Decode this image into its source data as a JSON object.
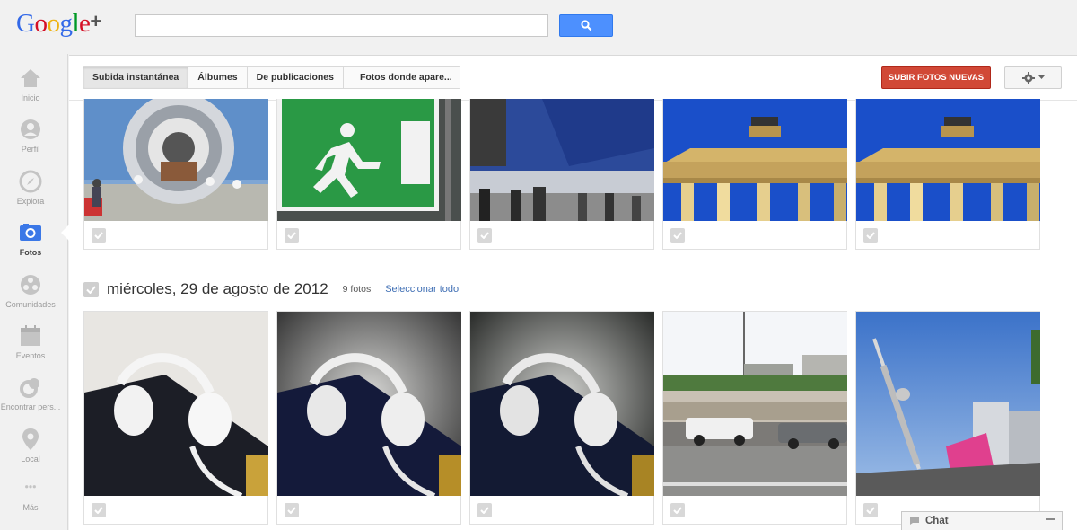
{
  "header": {
    "logo_text": "Google+",
    "search_placeholder": "",
    "search_icon": "search-icon"
  },
  "nav": {
    "items": [
      {
        "label": "Inicio",
        "icon": "home-icon"
      },
      {
        "label": "Perfil",
        "icon": "profile-icon"
      },
      {
        "label": "Explora",
        "icon": "compass-icon"
      },
      {
        "label": "Fotos",
        "icon": "camera-icon"
      },
      {
        "label": "Comunidades",
        "icon": "communities-icon"
      },
      {
        "label": "Eventos",
        "icon": "calendar-icon"
      },
      {
        "label": "Encontrar pers...",
        "icon": "find-people-icon"
      },
      {
        "label": "Local",
        "icon": "pin-icon"
      },
      {
        "label": "Más",
        "icon": "more-icon"
      }
    ],
    "active": "Fotos"
  },
  "toolbar": {
    "tabs": [
      "Subida instantánea",
      "Álbumes",
      "De publicaciones",
      "Fotos donde apare..."
    ],
    "active_tab": "Subida instantánea",
    "upload_label": "SUBIR FOTOS NUEVAS",
    "settings_icon": "gear-icon"
  },
  "section1": {
    "photos": [
      "IFA expo turbine booth",
      "green emergency exit sign",
      "expo hall with Smart TV banner",
      "Brandenburg Gate at night",
      "Brandenburg Gate at night"
    ]
  },
  "section2": {
    "date": "miércoles, 29 de agosto de 2012",
    "count": "9 fotos",
    "select_all": "Seleccionar todo",
    "photos": [
      "white headphones on backpack",
      "white headphones on backpack vignette",
      "white headphones on backpack vignette",
      "berlin street with cars",
      "berlin TV tower"
    ]
  },
  "chat": {
    "label": "Chat"
  },
  "colors": {
    "accent_blue": "#4d90fe",
    "upload_red": "#d14836",
    "link_blue": "#4170b5"
  }
}
